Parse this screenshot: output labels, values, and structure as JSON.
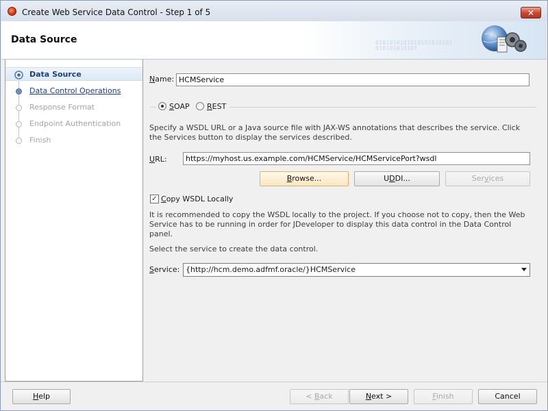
{
  "window": {
    "title": "Create Web Service Data Control - Step 1 of 5",
    "close_glyph": "✕"
  },
  "header": {
    "title": "Data Source",
    "binary_art": "0101010101010101010101\n010101010101"
  },
  "steps": [
    {
      "label": "Data Source",
      "state": "current"
    },
    {
      "label": "Data Control Operations",
      "state": "link"
    },
    {
      "label": "Response Format",
      "state": "disabled"
    },
    {
      "label": "Endpoint Authentication",
      "state": "disabled"
    },
    {
      "label": "Finish",
      "state": "disabled"
    }
  ],
  "form": {
    "name": {
      "label_u": "N",
      "label_rest": "ame:",
      "value": "HCMService"
    },
    "soap": {
      "label_u": "S",
      "label_rest": "OAP",
      "selected": true
    },
    "rest": {
      "label_u": "R",
      "label_rest": "EST",
      "selected": false
    },
    "wsdl_help": "Specify a WSDL URL or a Java source file with JAX-WS annotations that describes the service. Click the Services button to display the services described.",
    "url": {
      "label_u": "U",
      "label_rest": "RL:",
      "value": "https://myhost.us.example.com/HCMService/HCMServicePort?wsdl"
    },
    "browse_button": {
      "label_u": "B",
      "label_rest": "rowse..."
    },
    "uddi_button": {
      "label_pre": "U",
      "label_u": "D",
      "label_rest": "DI..."
    },
    "services_button": {
      "label_pre": "Ser",
      "label_u": "v",
      "label_rest": "ices"
    },
    "copy_wsdl": {
      "label_u": "C",
      "label_rest": "opy WSDL Locally",
      "checked": true,
      "check_glyph": "✓"
    },
    "copy_help": "It is recommended to copy the WSDL locally to the project. If you choose not to copy, then the Web Service has to be running in order for JDeveloper to display this data control in the Data Control panel.",
    "select_prompt": "Select the service to create the data control.",
    "service": {
      "label_u": "S",
      "label_rest": "ervice:",
      "value": "{http://hcm.demo.adfmf.oracle/}HCMService"
    }
  },
  "footer": {
    "help": {
      "label_u": "H",
      "label_rest": "elp"
    },
    "back": {
      "label_pre": "< ",
      "label_u": "B",
      "label_rest": "ack"
    },
    "next": {
      "label_u": "N",
      "label_rest": "ext >"
    },
    "finish": {
      "label_u": "F",
      "label_rest": "inish"
    },
    "cancel": {
      "label": "Cancel"
    }
  },
  "colors": {
    "accent": "#3d6bb8",
    "link": "#1d3f87",
    "focus_border": "#e5b15f",
    "close_red": "#c6452f"
  }
}
